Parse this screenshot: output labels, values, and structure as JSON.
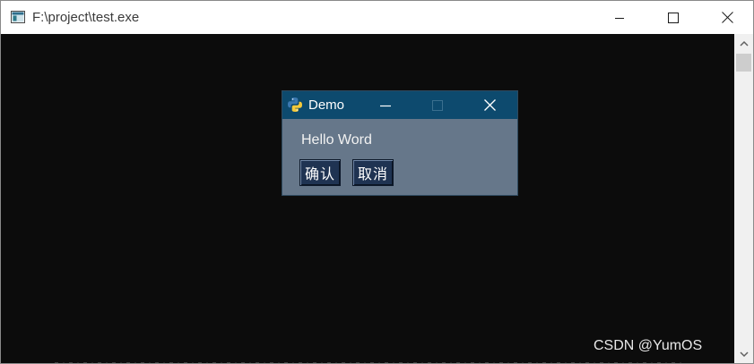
{
  "window": {
    "title": "F:\\project\\test.exe",
    "icons": {
      "app": "console-app-icon",
      "minimize": "minimize-icon",
      "maximize": "maximize-icon",
      "close": "close-icon"
    }
  },
  "scrollbar": {
    "icons": {
      "up": "chevron-up-icon",
      "down": "chevron-down-icon"
    }
  },
  "demo_dialog": {
    "title": "Demo",
    "label": "Hello Word",
    "buttons": {
      "confirm": "确认",
      "cancel": "取消"
    },
    "icons": {
      "app": "python-icon",
      "minimize": "minimize-icon",
      "maximize": "maximize-icon",
      "close": "close-icon"
    },
    "colors": {
      "titlebar": "#0d4a6e",
      "body": "#66778a",
      "button": "#1f3352"
    }
  },
  "watermark": "CSDN @YumOS"
}
